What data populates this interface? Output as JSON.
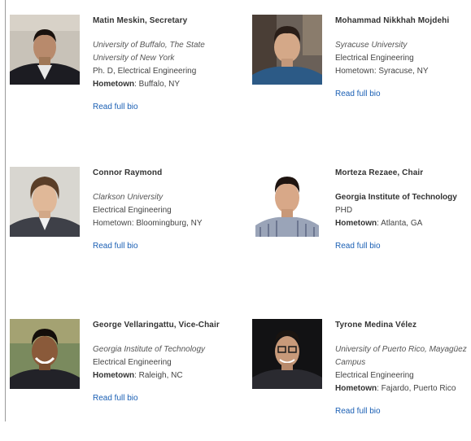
{
  "people": [
    {
      "name": "Matin Meskin, Secretary",
      "university": "University of Buffalo, The State University of New York",
      "degree": "Ph. D, Electrical Engineering",
      "field": "",
      "hometown_label": "Hometown",
      "hometown_sep": ": ",
      "hometown_value": "Buffalo, NY",
      "read_more": "Read full bio"
    },
    {
      "name": "Mohammad Nikkhah Mojdehi",
      "university": "Syracuse University",
      "degree": "",
      "field": "Electrical Engineering",
      "hometown_label": "Hometown",
      "hometown_sep": ": ",
      "hometown_value": "Syracuse, NY",
      "read_more": "Read full bio"
    },
    {
      "name": "Connor Raymond",
      "university": "Clarkson University",
      "degree": "",
      "field": "Electrical Engineering",
      "hometown_label": "Hometown",
      "hometown_sep": ": ",
      "hometown_value": "Bloomingburg, NY",
      "read_more": "Read full bio"
    },
    {
      "name": "Morteza Rezaee, Chair",
      "university": "Georgia Institute of Technology",
      "degree": "PHD",
      "field": "",
      "hometown_label": "Hometown",
      "hometown_sep": ": ",
      "hometown_value": "Atlanta, GA",
      "read_more": "Read full bio"
    },
    {
      "name": "George Vellaringattu, Vice-Chair",
      "university": "Georgia Institute of Technology",
      "degree": "",
      "field": "Electrical Engineering",
      "hometown_label": "Hometown",
      "hometown_sep": ": ",
      "hometown_value": "Raleigh, NC",
      "read_more": "Read full bio"
    },
    {
      "name": "Tyrone Medina Vélez",
      "university": "University of Puerto Rico, Mayagüez Campus",
      "degree": "",
      "field": "Electrical Engineering",
      "hometown_label": "Hometown",
      "hometown_sep": ": ",
      "hometown_value": "Fajardo, Puerto Rico",
      "read_more": "Read full bio"
    }
  ],
  "colors": {
    "link": "#1a5fb4",
    "text": "#333333",
    "border": "#9a9a9a"
  }
}
